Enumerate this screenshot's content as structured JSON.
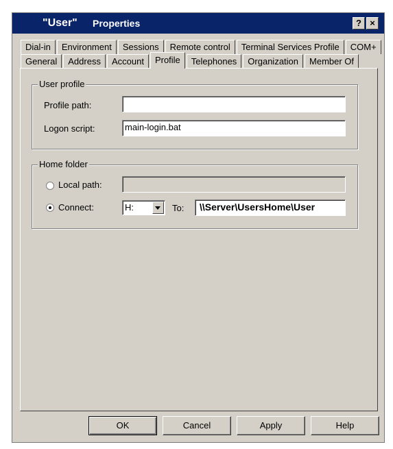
{
  "window": {
    "title_user": "\"User\"",
    "title_rest": "Properties",
    "help_glyph": "?",
    "close_glyph": "×"
  },
  "tabs": {
    "row1": [
      "Dial-in",
      "Environment",
      "Sessions",
      "Remote control",
      "Terminal Services Profile",
      "COM+"
    ],
    "row2": [
      "General",
      "Address",
      "Account",
      "Profile",
      "Telephones",
      "Organization",
      "Member Of"
    ],
    "active": "Profile"
  },
  "user_profile": {
    "legend": "User profile",
    "profile_path_label": "Profile path:",
    "profile_path_value": "",
    "logon_script_label": "Logon script:",
    "logon_script_value": "main-login.bat"
  },
  "home_folder": {
    "legend": "Home folder",
    "local_path_label": "Local path:",
    "local_path_value": "",
    "connect_label": "Connect:",
    "drive_value": "H:",
    "to_label": "To:",
    "to_value": "\\\\Server\\UsersHome\\User",
    "selected": "connect"
  },
  "buttons": {
    "ok": "OK",
    "cancel": "Cancel",
    "apply": "Apply",
    "help": "Help"
  },
  "icons": {
    "help": "question-mark-icon",
    "close": "close-x-icon",
    "dropdown": "chevron-down-icon"
  },
  "colors": {
    "titlebar": "#0a246a",
    "dialog_bg": "#d4d0c8"
  }
}
